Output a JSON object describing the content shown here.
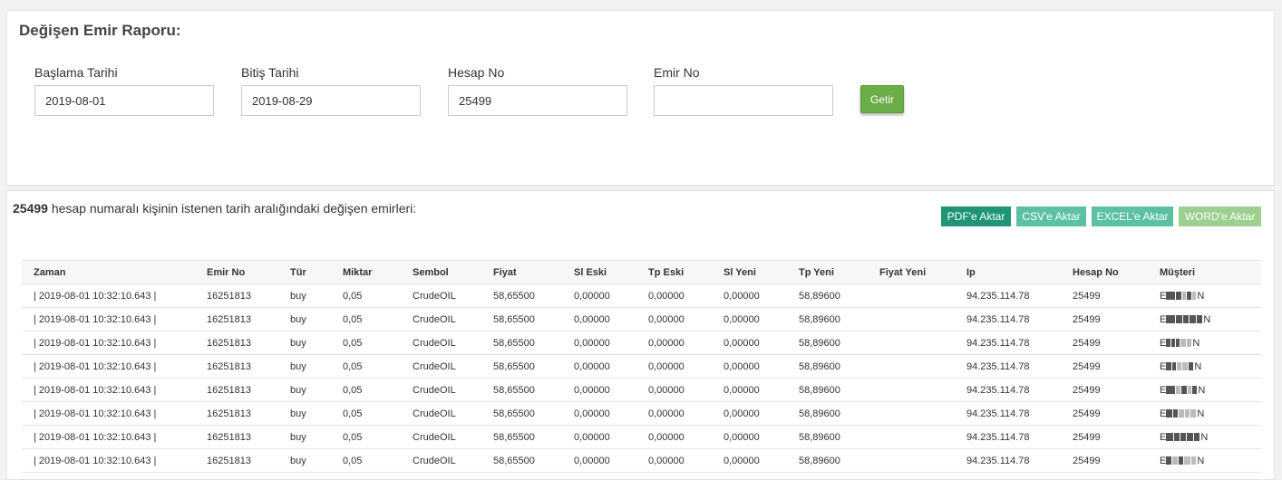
{
  "filter": {
    "title": "Değişen Emir Raporu:",
    "fields": [
      {
        "label": "Başlama Tarihi",
        "value": "2019-08-01"
      },
      {
        "label": "Bitiş Tarihi",
        "value": "2019-08-29"
      },
      {
        "label": "Hesap No",
        "value": "25499"
      },
      {
        "label": "Emir No",
        "value": ""
      }
    ],
    "submit_label": "Getir"
  },
  "report": {
    "account_bold": "25499",
    "summary_text": " hesap numaralı kişinin istenen tarih aralığındaki değişen emirleri:",
    "exports": {
      "pdf": "PDF'e Aktar",
      "csv": "CSV'e Aktar",
      "excel": "EXCEL'e Aktar",
      "word": "WORD'e Aktar"
    },
    "columns": [
      "Zaman",
      "Emir No",
      "Tür",
      "Miktar",
      "Sembol",
      "Fiyat",
      "Sl Eski",
      "Tp Eski",
      "Sl Yeni",
      "Tp Yeni",
      "Fiyat Yeni",
      "Ip",
      "Hesap No",
      "Müşteri"
    ],
    "rows": [
      {
        "zaman": "| 2019-08-01 10:32:10.643 |",
        "emir_no": "16251813",
        "tur": "buy",
        "miktar": "0,05",
        "sembol": "CrudeOIL",
        "fiyat": "58,65500",
        "sl_eski": "0,00000",
        "tp_eski": "0,00000",
        "sl_yeni": "0,00000",
        "tp_yeni": "58,89600",
        "fiyat_yeni": "",
        "ip": "94.235.114.78",
        "hesap_no": "25499",
        "musteri_first": "E",
        "musteri_last": "N"
      },
      {
        "zaman": "| 2019-08-01 10:32:10.643 |",
        "emir_no": "16251813",
        "tur": "buy",
        "miktar": "0,05",
        "sembol": "CrudeOIL",
        "fiyat": "58,65500",
        "sl_eski": "0,00000",
        "tp_eski": "0,00000",
        "sl_yeni": "0,00000",
        "tp_yeni": "58,89600",
        "fiyat_yeni": "",
        "ip": "94.235.114.78",
        "hesap_no": "25499",
        "musteri_first": "E",
        "musteri_last": "N"
      },
      {
        "zaman": "| 2019-08-01 10:32:10.643 |",
        "emir_no": "16251813",
        "tur": "buy",
        "miktar": "0,05",
        "sembol": "CrudeOIL",
        "fiyat": "58,65500",
        "sl_eski": "0,00000",
        "tp_eski": "0,00000",
        "sl_yeni": "0,00000",
        "tp_yeni": "58,89600",
        "fiyat_yeni": "",
        "ip": "94.235.114.78",
        "hesap_no": "25499",
        "musteri_first": "E",
        "musteri_last": "N"
      },
      {
        "zaman": "| 2019-08-01 10:32:10.643 |",
        "emir_no": "16251813",
        "tur": "buy",
        "miktar": "0,05",
        "sembol": "CrudeOIL",
        "fiyat": "58,65500",
        "sl_eski": "0,00000",
        "tp_eski": "0,00000",
        "sl_yeni": "0,00000",
        "tp_yeni": "58,89600",
        "fiyat_yeni": "",
        "ip": "94.235.114.78",
        "hesap_no": "25499",
        "musteri_first": "E",
        "musteri_last": "N"
      },
      {
        "zaman": "| 2019-08-01 10:32:10.643 |",
        "emir_no": "16251813",
        "tur": "buy",
        "miktar": "0,05",
        "sembol": "CrudeOIL",
        "fiyat": "58,65500",
        "sl_eski": "0,00000",
        "tp_eski": "0,00000",
        "sl_yeni": "0,00000",
        "tp_yeni": "58,89600",
        "fiyat_yeni": "",
        "ip": "94.235.114.78",
        "hesap_no": "25499",
        "musteri_first": "E",
        "musteri_last": "N"
      },
      {
        "zaman": "| 2019-08-01 10:32:10.643 |",
        "emir_no": "16251813",
        "tur": "buy",
        "miktar": "0,05",
        "sembol": "CrudeOIL",
        "fiyat": "58,65500",
        "sl_eski": "0,00000",
        "tp_eski": "0,00000",
        "sl_yeni": "0,00000",
        "tp_yeni": "58,89600",
        "fiyat_yeni": "",
        "ip": "94.235.114.78",
        "hesap_no": "25499",
        "musteri_first": "E",
        "musteri_last": "N"
      },
      {
        "zaman": "| 2019-08-01 10:32:10.643 |",
        "emir_no": "16251813",
        "tur": "buy",
        "miktar": "0,05",
        "sembol": "CrudeOIL",
        "fiyat": "58,65500",
        "sl_eski": "0,00000",
        "tp_eski": "0,00000",
        "sl_yeni": "0,00000",
        "tp_yeni": "58,89600",
        "fiyat_yeni": "",
        "ip": "94.235.114.78",
        "hesap_no": "25499",
        "musteri_first": "E",
        "musteri_last": "N"
      },
      {
        "zaman": "| 2019-08-01 10:32:10.643 |",
        "emir_no": "16251813",
        "tur": "buy",
        "miktar": "0,05",
        "sembol": "CrudeOIL",
        "fiyat": "58,65500",
        "sl_eski": "0,00000",
        "tp_eski": "0,00000",
        "sl_yeni": "0,00000",
        "tp_yeni": "58,89600",
        "fiyat_yeni": "",
        "ip": "94.235.114.78",
        "hesap_no": "25499",
        "musteri_first": "E",
        "musteri_last": "N"
      }
    ]
  }
}
